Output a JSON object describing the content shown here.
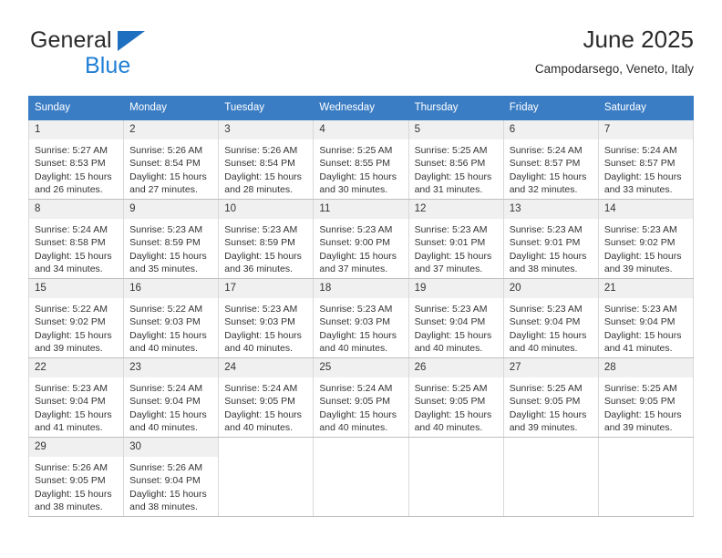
{
  "brand": {
    "word_one": "General",
    "word_two": "Blue",
    "triangle_color": "#1f6fc0",
    "blue_color": "#1f7fd6"
  },
  "header": {
    "title": "June 2025",
    "location": "Campodarsego, Veneto, Italy"
  },
  "theme": {
    "header_bg": "#3b7dc4",
    "daynum_bg": "#f0f0f0",
    "grid_line": "#d9d9d9"
  },
  "weekdays": [
    "Sunday",
    "Monday",
    "Tuesday",
    "Wednesday",
    "Thursday",
    "Friday",
    "Saturday"
  ],
  "weeks": [
    [
      {
        "day": "1",
        "sunrise": "Sunrise: 5:27 AM",
        "sunset": "Sunset: 8:53 PM",
        "daylight_a": "Daylight: 15 hours",
        "daylight_b": "and 26 minutes."
      },
      {
        "day": "2",
        "sunrise": "Sunrise: 5:26 AM",
        "sunset": "Sunset: 8:54 PM",
        "daylight_a": "Daylight: 15 hours",
        "daylight_b": "and 27 minutes."
      },
      {
        "day": "3",
        "sunrise": "Sunrise: 5:26 AM",
        "sunset": "Sunset: 8:54 PM",
        "daylight_a": "Daylight: 15 hours",
        "daylight_b": "and 28 minutes."
      },
      {
        "day": "4",
        "sunrise": "Sunrise: 5:25 AM",
        "sunset": "Sunset: 8:55 PM",
        "daylight_a": "Daylight: 15 hours",
        "daylight_b": "and 30 minutes."
      },
      {
        "day": "5",
        "sunrise": "Sunrise: 5:25 AM",
        "sunset": "Sunset: 8:56 PM",
        "daylight_a": "Daylight: 15 hours",
        "daylight_b": "and 31 minutes."
      },
      {
        "day": "6",
        "sunrise": "Sunrise: 5:24 AM",
        "sunset": "Sunset: 8:57 PM",
        "daylight_a": "Daylight: 15 hours",
        "daylight_b": "and 32 minutes."
      },
      {
        "day": "7",
        "sunrise": "Sunrise: 5:24 AM",
        "sunset": "Sunset: 8:57 PM",
        "daylight_a": "Daylight: 15 hours",
        "daylight_b": "and 33 minutes."
      }
    ],
    [
      {
        "day": "8",
        "sunrise": "Sunrise: 5:24 AM",
        "sunset": "Sunset: 8:58 PM",
        "daylight_a": "Daylight: 15 hours",
        "daylight_b": "and 34 minutes."
      },
      {
        "day": "9",
        "sunrise": "Sunrise: 5:23 AM",
        "sunset": "Sunset: 8:59 PM",
        "daylight_a": "Daylight: 15 hours",
        "daylight_b": "and 35 minutes."
      },
      {
        "day": "10",
        "sunrise": "Sunrise: 5:23 AM",
        "sunset": "Sunset: 8:59 PM",
        "daylight_a": "Daylight: 15 hours",
        "daylight_b": "and 36 minutes."
      },
      {
        "day": "11",
        "sunrise": "Sunrise: 5:23 AM",
        "sunset": "Sunset: 9:00 PM",
        "daylight_a": "Daylight: 15 hours",
        "daylight_b": "and 37 minutes."
      },
      {
        "day": "12",
        "sunrise": "Sunrise: 5:23 AM",
        "sunset": "Sunset: 9:01 PM",
        "daylight_a": "Daylight: 15 hours",
        "daylight_b": "and 37 minutes."
      },
      {
        "day": "13",
        "sunrise": "Sunrise: 5:23 AM",
        "sunset": "Sunset: 9:01 PM",
        "daylight_a": "Daylight: 15 hours",
        "daylight_b": "and 38 minutes."
      },
      {
        "day": "14",
        "sunrise": "Sunrise: 5:23 AM",
        "sunset": "Sunset: 9:02 PM",
        "daylight_a": "Daylight: 15 hours",
        "daylight_b": "and 39 minutes."
      }
    ],
    [
      {
        "day": "15",
        "sunrise": "Sunrise: 5:22 AM",
        "sunset": "Sunset: 9:02 PM",
        "daylight_a": "Daylight: 15 hours",
        "daylight_b": "and 39 minutes."
      },
      {
        "day": "16",
        "sunrise": "Sunrise: 5:22 AM",
        "sunset": "Sunset: 9:03 PM",
        "daylight_a": "Daylight: 15 hours",
        "daylight_b": "and 40 minutes."
      },
      {
        "day": "17",
        "sunrise": "Sunrise: 5:23 AM",
        "sunset": "Sunset: 9:03 PM",
        "daylight_a": "Daylight: 15 hours",
        "daylight_b": "and 40 minutes."
      },
      {
        "day": "18",
        "sunrise": "Sunrise: 5:23 AM",
        "sunset": "Sunset: 9:03 PM",
        "daylight_a": "Daylight: 15 hours",
        "daylight_b": "and 40 minutes."
      },
      {
        "day": "19",
        "sunrise": "Sunrise: 5:23 AM",
        "sunset": "Sunset: 9:04 PM",
        "daylight_a": "Daylight: 15 hours",
        "daylight_b": "and 40 minutes."
      },
      {
        "day": "20",
        "sunrise": "Sunrise: 5:23 AM",
        "sunset": "Sunset: 9:04 PM",
        "daylight_a": "Daylight: 15 hours",
        "daylight_b": "and 40 minutes."
      },
      {
        "day": "21",
        "sunrise": "Sunrise: 5:23 AM",
        "sunset": "Sunset: 9:04 PM",
        "daylight_a": "Daylight: 15 hours",
        "daylight_b": "and 41 minutes."
      }
    ],
    [
      {
        "day": "22",
        "sunrise": "Sunrise: 5:23 AM",
        "sunset": "Sunset: 9:04 PM",
        "daylight_a": "Daylight: 15 hours",
        "daylight_b": "and 41 minutes."
      },
      {
        "day": "23",
        "sunrise": "Sunrise: 5:24 AM",
        "sunset": "Sunset: 9:04 PM",
        "daylight_a": "Daylight: 15 hours",
        "daylight_b": "and 40 minutes."
      },
      {
        "day": "24",
        "sunrise": "Sunrise: 5:24 AM",
        "sunset": "Sunset: 9:05 PM",
        "daylight_a": "Daylight: 15 hours",
        "daylight_b": "and 40 minutes."
      },
      {
        "day": "25",
        "sunrise": "Sunrise: 5:24 AM",
        "sunset": "Sunset: 9:05 PM",
        "daylight_a": "Daylight: 15 hours",
        "daylight_b": "and 40 minutes."
      },
      {
        "day": "26",
        "sunrise": "Sunrise: 5:25 AM",
        "sunset": "Sunset: 9:05 PM",
        "daylight_a": "Daylight: 15 hours",
        "daylight_b": "and 40 minutes."
      },
      {
        "day": "27",
        "sunrise": "Sunrise: 5:25 AM",
        "sunset": "Sunset: 9:05 PM",
        "daylight_a": "Daylight: 15 hours",
        "daylight_b": "and 39 minutes."
      },
      {
        "day": "28",
        "sunrise": "Sunrise: 5:25 AM",
        "sunset": "Sunset: 9:05 PM",
        "daylight_a": "Daylight: 15 hours",
        "daylight_b": "and 39 minutes."
      }
    ],
    [
      {
        "day": "29",
        "sunrise": "Sunrise: 5:26 AM",
        "sunset": "Sunset: 9:05 PM",
        "daylight_a": "Daylight: 15 hours",
        "daylight_b": "and 38 minutes."
      },
      {
        "day": "30",
        "sunrise": "Sunrise: 5:26 AM",
        "sunset": "Sunset: 9:04 PM",
        "daylight_a": "Daylight: 15 hours",
        "daylight_b": "and 38 minutes."
      },
      null,
      null,
      null,
      null,
      null
    ]
  ]
}
